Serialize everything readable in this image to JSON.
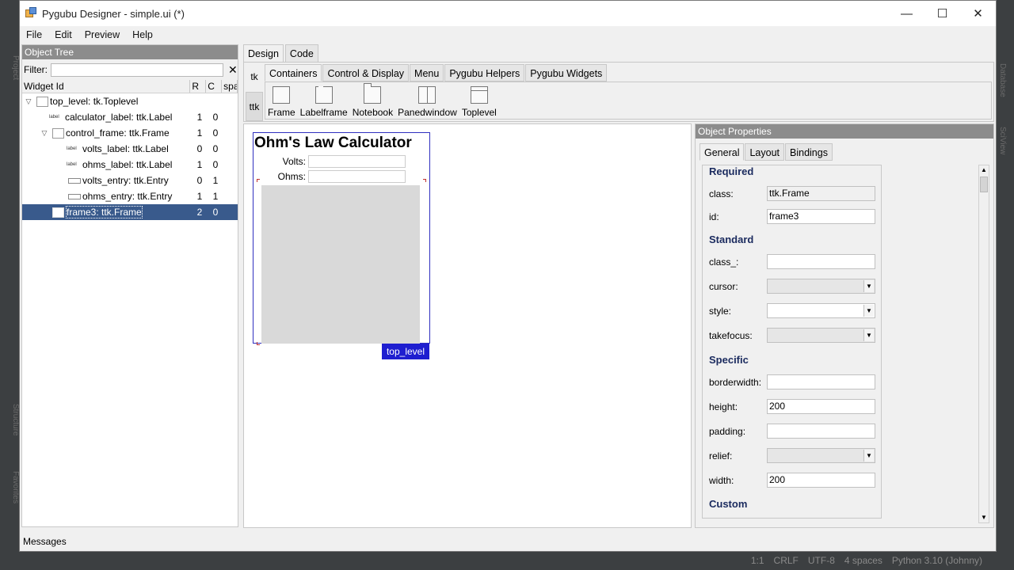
{
  "window": {
    "title": "Pygubu Designer - simple.ui (*)",
    "minimize": "—",
    "maximize": "☐",
    "close": "✕"
  },
  "menu": [
    "File",
    "Edit",
    "Preview",
    "Help"
  ],
  "object_tree": {
    "title": "Object Tree",
    "filter_label": "Filter:",
    "filter_value": "",
    "clear": "✕",
    "columns": {
      "id": "Widget Id",
      "r": "R",
      "c": "C",
      "span": "spa"
    },
    "rows": [
      {
        "name": "top_level: tk.Toplevel",
        "r": "",
        "c": ""
      },
      {
        "name": "calculator_label: ttk.Label",
        "r": "1",
        "c": "0"
      },
      {
        "name": "control_frame: ttk.Frame",
        "r": "1",
        "c": "0"
      },
      {
        "name": "volts_label: ttk.Label",
        "r": "0",
        "c": "0"
      },
      {
        "name": "ohms_label: ttk.Label",
        "r": "1",
        "c": "0"
      },
      {
        "name": "volts_entry: ttk.Entry",
        "r": "0",
        "c": "1"
      },
      {
        "name": "ohms_entry: ttk.Entry",
        "r": "1",
        "c": "1"
      },
      {
        "name": "frame3: ttk.Frame",
        "r": "2",
        "c": "0"
      }
    ],
    "label_icon_text": "label"
  },
  "notebook_tabs": [
    "Design",
    "Code"
  ],
  "palette": {
    "side": [
      "tk",
      "ttk"
    ],
    "tabs": [
      "Containers",
      "Control & Display",
      "Menu",
      "Pygubu Helpers",
      "Pygubu Widgets"
    ],
    "widgets": [
      "Frame",
      "Labelframe",
      "Notebook",
      "Panedwindow",
      "Toplevel"
    ]
  },
  "preview": {
    "title": "Ohm's Law Calculator",
    "volts_label": "Volts:",
    "ohms_label": "Ohms:",
    "toplevel_tag": "top_level"
  },
  "properties": {
    "title": "Object Properties",
    "tabs": [
      "General",
      "Layout",
      "Bindings"
    ],
    "required": "Required",
    "class_label": "class:",
    "class_value": "ttk.Frame",
    "id_label": "id:",
    "id_value": "frame3",
    "standard": "Standard",
    "class__label": "class_:",
    "cursor_label": "cursor:",
    "style_label": "style:",
    "takefocus_label": "takefocus:",
    "specific": "Specific",
    "borderwidth_label": "borderwidth:",
    "height_label": "height:",
    "height_value": "200",
    "padding_label": "padding:",
    "relief_label": "relief:",
    "width_label": "width:",
    "width_value": "200",
    "custom": "Custom"
  },
  "messages": "Messages",
  "ide_status": [
    "1:1",
    "CRLF",
    "UTF-8",
    "4 spaces",
    "Python 3.10 (Johnny)"
  ],
  "ide_side_left": [
    "Project",
    "Structure",
    "Favorites"
  ],
  "ide_side_right": [
    "Database",
    "SciView"
  ]
}
